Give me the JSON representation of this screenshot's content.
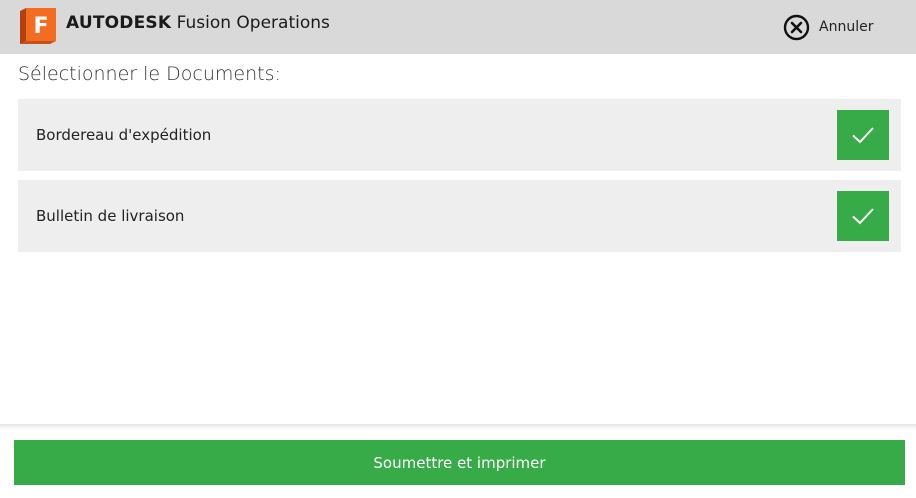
{
  "header": {
    "brand_bold": "AUTODESK",
    "brand_rest": " Fusion Operations",
    "logo_icon": "fusion-f-logo",
    "cancel_icon": "close-circle-icon",
    "cancel_label": "Annuler"
  },
  "main": {
    "title": "Sélectionner le Documents:",
    "documents": [
      {
        "label": "Bordereau d'expédition",
        "selected": true
      },
      {
        "label": "Bulletin de livraison",
        "selected": true
      }
    ]
  },
  "footer": {
    "submit_label": "Soumettre et imprimer"
  },
  "colors": {
    "accent_green": "#37ab48",
    "header_bg": "#d9d9d9",
    "row_bg": "#eeeeee",
    "logo_orange": "#f26d21"
  }
}
